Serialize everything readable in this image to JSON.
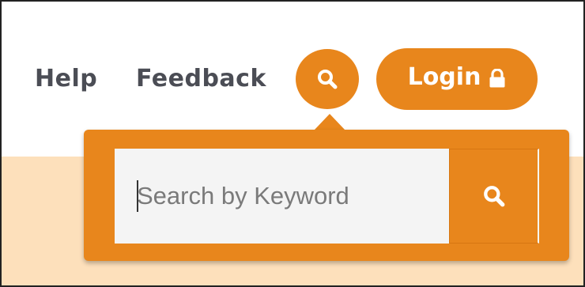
{
  "nav": {
    "help_label": "Help",
    "feedback_label": "Feedback",
    "search_icon": "search-icon",
    "login_label": "Login",
    "lock_icon": "lock-icon"
  },
  "search": {
    "placeholder": "Search by Keyword",
    "value": "",
    "submit_icon": "search-icon"
  },
  "colors": {
    "accent": "#e8861c",
    "banner": "#fde0bb",
    "nav_text": "#4b4d55",
    "input_bg": "#f4f4f4"
  }
}
